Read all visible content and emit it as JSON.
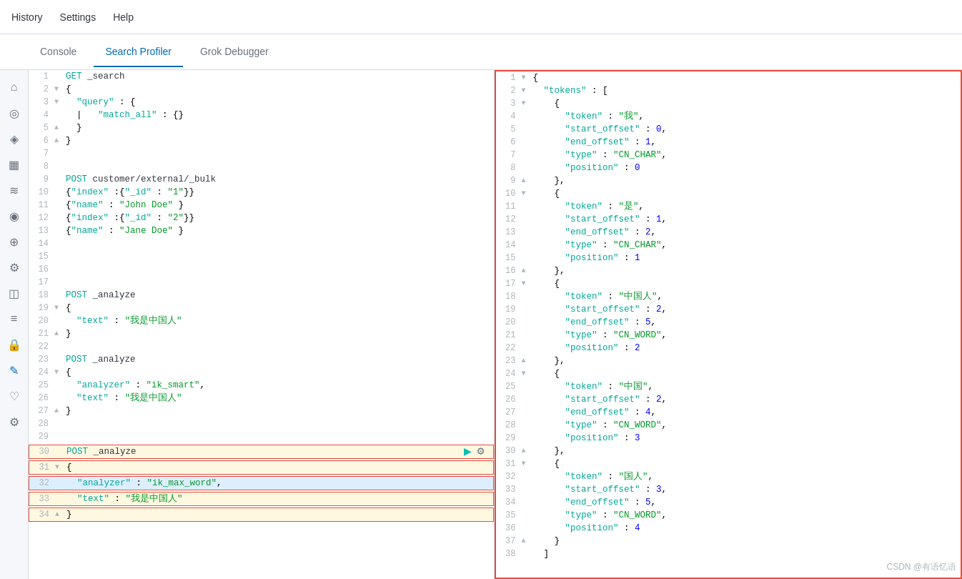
{
  "topbar": {
    "history_label": "History",
    "settings_label": "Settings",
    "help_label": "Help"
  },
  "tabs": [
    {
      "id": "console",
      "label": "Console",
      "active": false
    },
    {
      "id": "search-profiler",
      "label": "Search Profiler",
      "active": true
    },
    {
      "id": "grok-debugger",
      "label": "Grok Debugger",
      "active": false
    }
  ],
  "left_code": [
    {
      "line": 1,
      "content": "GET _search",
      "toggle": null
    },
    {
      "line": 2,
      "content": "{",
      "toggle": "▼"
    },
    {
      "line": 3,
      "content": "  \"query\": {",
      "toggle": "▼"
    },
    {
      "line": 4,
      "content": "  |   \"match_all\": {}",
      "toggle": null
    },
    {
      "line": 5,
      "content": "  }",
      "toggle": "▲"
    },
    {
      "line": 6,
      "content": "}",
      "toggle": "▲"
    },
    {
      "line": 7,
      "content": "",
      "toggle": null
    },
    {
      "line": 8,
      "content": "",
      "toggle": null
    },
    {
      "line": 9,
      "content": "POST customer/external/_bulk",
      "toggle": null
    },
    {
      "line": 10,
      "content": "{\"index\":{\"_id\":\"1\"}}",
      "toggle": null
    },
    {
      "line": 11,
      "content": "{\"name\": \"John Doe\" }",
      "toggle": null
    },
    {
      "line": 12,
      "content": "{\"index\":{\"_id\":\"2\"}}",
      "toggle": null
    },
    {
      "line": 13,
      "content": "{\"name\": \"Jane Doe\" }",
      "toggle": null
    },
    {
      "line": 14,
      "content": "",
      "toggle": null
    },
    {
      "line": 15,
      "content": "",
      "toggle": null
    },
    {
      "line": 16,
      "content": "",
      "toggle": null
    },
    {
      "line": 17,
      "content": "",
      "toggle": null
    },
    {
      "line": 18,
      "content": "POST _analyze",
      "toggle": null
    },
    {
      "line": 19,
      "content": "{",
      "toggle": "▼"
    },
    {
      "line": 20,
      "content": "  \"text\": \"我是中国人\"",
      "toggle": null
    },
    {
      "line": 21,
      "content": "}",
      "toggle": "▲"
    },
    {
      "line": 22,
      "content": "",
      "toggle": null
    },
    {
      "line": 23,
      "content": "POST _analyze",
      "toggle": null
    },
    {
      "line": 24,
      "content": "{",
      "toggle": "▼"
    },
    {
      "line": 25,
      "content": "  \"analyzer\": \"ik_smart\",",
      "toggle": null
    },
    {
      "line": 26,
      "content": "  \"text\": \"我是中国人\"",
      "toggle": null
    },
    {
      "line": 27,
      "content": "}",
      "toggle": "▲"
    },
    {
      "line": 28,
      "content": "",
      "toggle": null
    },
    {
      "line": 29,
      "content": "",
      "toggle": null
    },
    {
      "line": 30,
      "content": "POST _analyze",
      "toggle": null,
      "selected": true
    },
    {
      "line": 31,
      "content": "{",
      "toggle": "▼",
      "selected": true
    },
    {
      "line": 32,
      "content": "  \"analyzer\": \"ik_max_word\",",
      "toggle": null,
      "selected": true,
      "cursor": true
    },
    {
      "line": 33,
      "content": "  \"text\": \"我是中国人\"",
      "toggle": null,
      "selected": true
    },
    {
      "line": 34,
      "content": "}",
      "toggle": "▲",
      "selected": true
    }
  ],
  "right_code": [
    {
      "line": 1,
      "content": "{",
      "toggle": "▼"
    },
    {
      "line": 2,
      "content": "  \"tokens\" : [",
      "toggle": "▼"
    },
    {
      "line": 3,
      "content": "    {",
      "toggle": "▼"
    },
    {
      "line": 4,
      "content": "      \"token\" : \"我\",",
      "toggle": null
    },
    {
      "line": 5,
      "content": "      \"start_offset\" : 0,",
      "toggle": null
    },
    {
      "line": 6,
      "content": "      \"end_offset\" : 1,",
      "toggle": null
    },
    {
      "line": 7,
      "content": "      \"type\" : \"CN_CHAR\",",
      "toggle": null
    },
    {
      "line": 8,
      "content": "      \"position\" : 0",
      "toggle": null
    },
    {
      "line": 9,
      "content": "    },",
      "toggle": "▲"
    },
    {
      "line": 10,
      "content": "    {",
      "toggle": "▼"
    },
    {
      "line": 11,
      "content": "      \"token\" : \"是\",",
      "toggle": null
    },
    {
      "line": 12,
      "content": "      \"start_offset\" : 1,",
      "toggle": null
    },
    {
      "line": 13,
      "content": "      \"end_offset\" : 2,",
      "toggle": null
    },
    {
      "line": 14,
      "content": "      \"type\" : \"CN_CHAR\",",
      "toggle": null
    },
    {
      "line": 15,
      "content": "      \"position\" : 1",
      "toggle": null
    },
    {
      "line": 16,
      "content": "    },",
      "toggle": "▲"
    },
    {
      "line": 17,
      "content": "    {",
      "toggle": "▼"
    },
    {
      "line": 18,
      "content": "      \"token\" : \"中国人\",",
      "toggle": null
    },
    {
      "line": 19,
      "content": "      \"start_offset\" : 2,",
      "toggle": null
    },
    {
      "line": 20,
      "content": "      \"end_offset\" : 5,",
      "toggle": null
    },
    {
      "line": 21,
      "content": "      \"type\" : \"CN_WORD\",",
      "toggle": null
    },
    {
      "line": 22,
      "content": "      \"position\" : 2",
      "toggle": null
    },
    {
      "line": 23,
      "content": "    },",
      "toggle": "▲"
    },
    {
      "line": 24,
      "content": "    {",
      "toggle": "▼"
    },
    {
      "line": 25,
      "content": "      \"token\" : \"中国\",",
      "toggle": null
    },
    {
      "line": 26,
      "content": "      \"start_offset\" : 2,",
      "toggle": null
    },
    {
      "line": 27,
      "content": "      \"end_offset\" : 4,",
      "toggle": null
    },
    {
      "line": 28,
      "content": "      \"type\" : \"CN_WORD\",",
      "toggle": null
    },
    {
      "line": 29,
      "content": "      \"position\" : 3",
      "toggle": null
    },
    {
      "line": 30,
      "content": "    },",
      "toggle": "▲"
    },
    {
      "line": 31,
      "content": "    {",
      "toggle": "▼"
    },
    {
      "line": 32,
      "content": "      \"token\" : \"国人\",",
      "toggle": null
    },
    {
      "line": 33,
      "content": "      \"start_offset\" : 3,",
      "toggle": null
    },
    {
      "line": 34,
      "content": "      \"end_offset\" : 5,",
      "toggle": null
    },
    {
      "line": 35,
      "content": "      \"type\" : \"CN_WORD\",",
      "toggle": null
    },
    {
      "line": 36,
      "content": "      \"position\" : 4",
      "toggle": null
    },
    {
      "line": 37,
      "content": "    }",
      "toggle": "▲"
    },
    {
      "line": 38,
      "content": "  ]",
      "toggle": null
    }
  ],
  "sidebar_icons": [
    {
      "id": "home",
      "icon": "⌂",
      "label": "home-icon"
    },
    {
      "id": "discover",
      "icon": "⊙",
      "label": "discover-icon"
    },
    {
      "id": "visualize",
      "icon": "◈",
      "label": "visualize-icon"
    },
    {
      "id": "dashboard",
      "icon": "▦",
      "label": "dashboard-icon"
    },
    {
      "id": "timelion",
      "icon": "≋",
      "label": "timelion-icon"
    },
    {
      "id": "apm",
      "icon": "◉",
      "label": "apm-icon"
    },
    {
      "id": "maps",
      "icon": "⊕",
      "label": "maps-icon"
    },
    {
      "id": "ml",
      "icon": "⚙",
      "label": "ml-icon"
    },
    {
      "id": "infrastructure",
      "icon": "◫",
      "label": "infrastructure-icon"
    },
    {
      "id": "logs",
      "icon": "≡",
      "label": "logs-icon"
    },
    {
      "id": "security",
      "icon": "⊘",
      "label": "security-icon"
    },
    {
      "id": "dev-tools",
      "icon": "✎",
      "label": "dev-tools-icon",
      "active": true
    },
    {
      "id": "monitoring",
      "icon": "♡",
      "label": "monitoring-icon"
    },
    {
      "id": "management",
      "icon": "⚙",
      "label": "management-icon"
    }
  ],
  "watermark": "CSDN @有语忆语"
}
